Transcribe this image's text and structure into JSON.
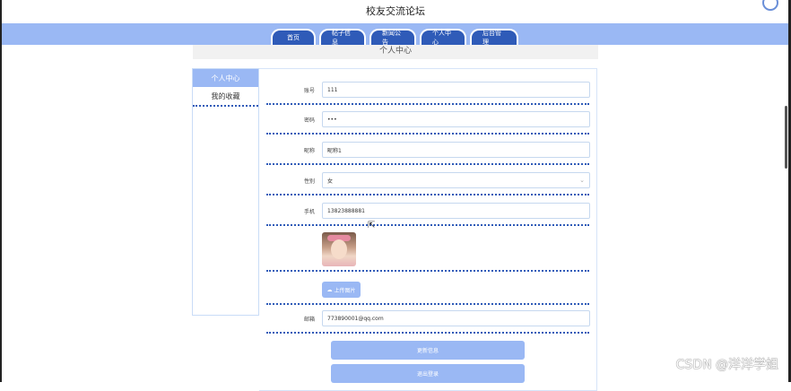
{
  "site": {
    "title": "校友交流论坛"
  },
  "nav": {
    "tabs": [
      {
        "label": "首页"
      },
      {
        "label": "帖子信息"
      },
      {
        "label": "新闻公告"
      },
      {
        "label": "个人中心"
      },
      {
        "label": "后台管理"
      }
    ]
  },
  "page": {
    "heading": "个人中心"
  },
  "sidebar": {
    "items": [
      {
        "label": "个人中心",
        "active": true
      },
      {
        "label": "我的收藏",
        "active": false
      }
    ]
  },
  "form": {
    "account": {
      "label": "账号",
      "value": "111"
    },
    "password": {
      "label": "密码",
      "value": "•••"
    },
    "nickname": {
      "label": "昵称",
      "value": "昵称1"
    },
    "gender": {
      "label": "性别",
      "value": "女"
    },
    "phone": {
      "label": "手机",
      "value": "13823888881"
    },
    "upload_label": "上传图片",
    "email": {
      "label": "邮箱",
      "value": "773890001@qq.com"
    }
  },
  "buttons": {
    "update": "更新信息",
    "logout": "退出登录"
  },
  "watermark": "CSDN @洋洋学姐",
  "colors": {
    "nav_bar": "#9ab8f4",
    "nav_tab": "#2f5bb8",
    "accent": "#9ab8f4",
    "divider": "#2f5bb8"
  },
  "icons": {
    "upload": "cloud-upload-icon",
    "select": "chevron-down-icon"
  }
}
